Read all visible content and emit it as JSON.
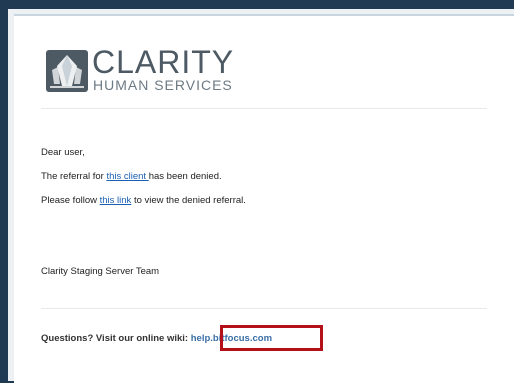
{
  "logo": {
    "name": "CLARITY",
    "subtitle": "HUMAN SERVICES"
  },
  "email": {
    "greeting": "Dear user,",
    "line1_prefix": "The referral for ",
    "line1_link": "this client ",
    "line1_suffix": "has been denied.",
    "line2_prefix": "Please follow ",
    "line2_link": "this link",
    "line2_suffix": " to view the denied referral.",
    "signature": "Clarity Staging Server Team"
  },
  "footer": {
    "question": "Questions? Visit our online wiki: ",
    "wiki_link": "help.bitfocus.com"
  },
  "colors": {
    "background": "#1f3a52",
    "link": "#1a5fb4",
    "highlight": "#b3101a"
  }
}
